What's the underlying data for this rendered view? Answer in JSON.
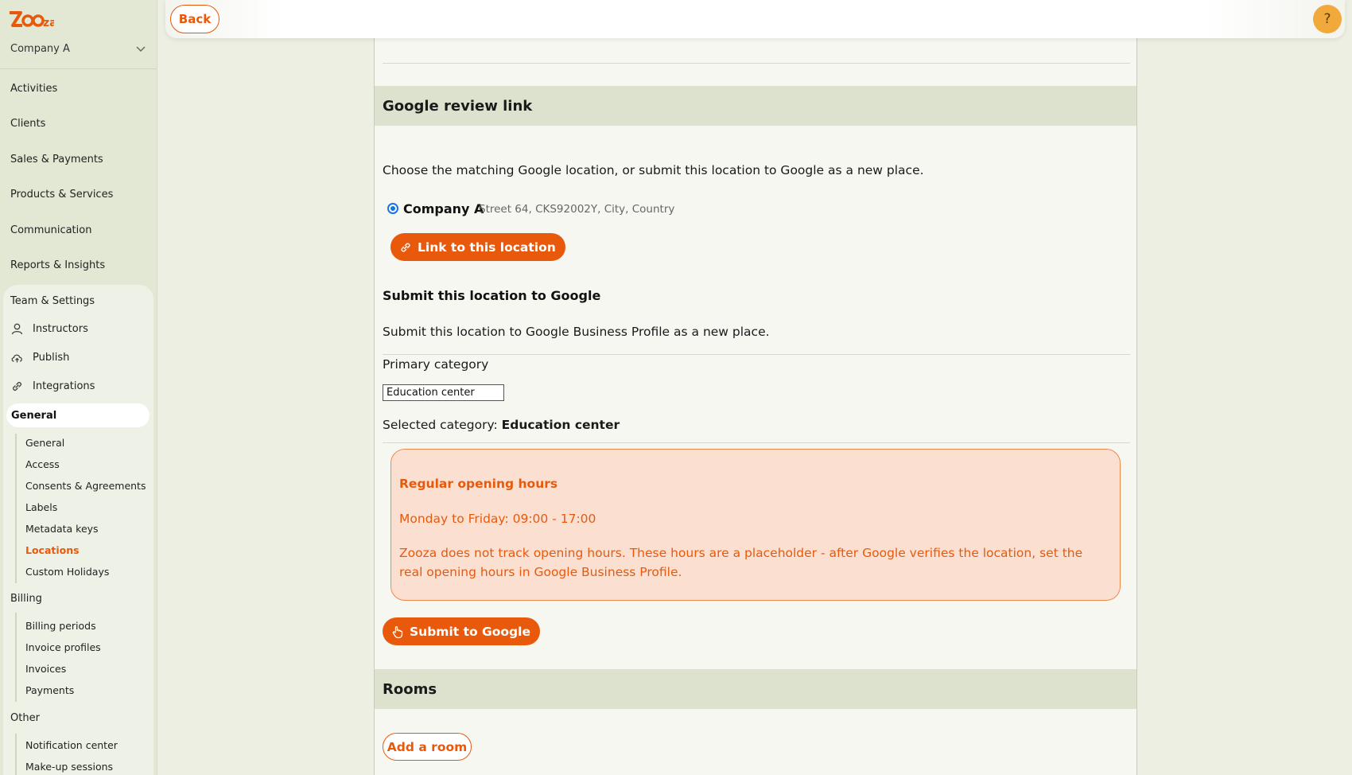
{
  "app": {
    "logo_text": "zooza",
    "company": "Company A",
    "accent_color": "#e8590c"
  },
  "sidebar": {
    "nav": [
      {
        "label": "Activities"
      },
      {
        "label": "Clients"
      },
      {
        "label": "Sales & Payments"
      },
      {
        "label": "Products & Services"
      },
      {
        "label": "Communication"
      },
      {
        "label": "Reports & Insights"
      }
    ],
    "settings_title": "Team & Settings",
    "settings_items": [
      {
        "label": "Instructors",
        "icon": "person-icon"
      },
      {
        "label": "Publish",
        "icon": "cloud-upload-icon"
      },
      {
        "label": "Integrations",
        "icon": "link-icon"
      }
    ],
    "general_group": "General",
    "general_items": [
      {
        "label": "General"
      },
      {
        "label": "Access"
      },
      {
        "label": "Consents & Agreements"
      },
      {
        "label": "Labels"
      },
      {
        "label": "Metadata keys"
      },
      {
        "label": "Locations"
      },
      {
        "label": "Custom Holidays"
      }
    ],
    "billing_group": "Billing",
    "billing_items": [
      {
        "label": "Billing periods"
      },
      {
        "label": "Invoice profiles"
      },
      {
        "label": "Invoices"
      },
      {
        "label": "Payments"
      }
    ],
    "other_group": "Other",
    "other_items": [
      {
        "label": "Notification center"
      },
      {
        "label": "Make-up sessions"
      }
    ]
  },
  "topbar": {
    "back_label": "Back",
    "help_label": "?"
  },
  "google_section": {
    "title": "Google review link",
    "instruction": "Choose the matching Google location, or submit this location to Google as a new place.",
    "location_name": "Company A",
    "location_address": "Street 64, CKS92002Y, City, Country",
    "link_button": "Link to this location",
    "submit_title": "Submit this location to Google",
    "submit_desc": "Submit this location to Google Business Profile as a new place.",
    "category_label": "Primary category",
    "category_value": "Education center",
    "selected_prefix": "Selected category:",
    "selected_value": "Education center",
    "notice": {
      "title": "Regular opening hours",
      "hours": "Monday to Friday: 09:00 - 17:00",
      "desc": "Zooza does not track opening hours. These hours are a placeholder - after Google verifies the location, set the real opening hours in Google Business Profile."
    },
    "submit_button": "Submit to Google"
  },
  "rooms_section": {
    "title": "Rooms",
    "add_button": "Add a room"
  }
}
